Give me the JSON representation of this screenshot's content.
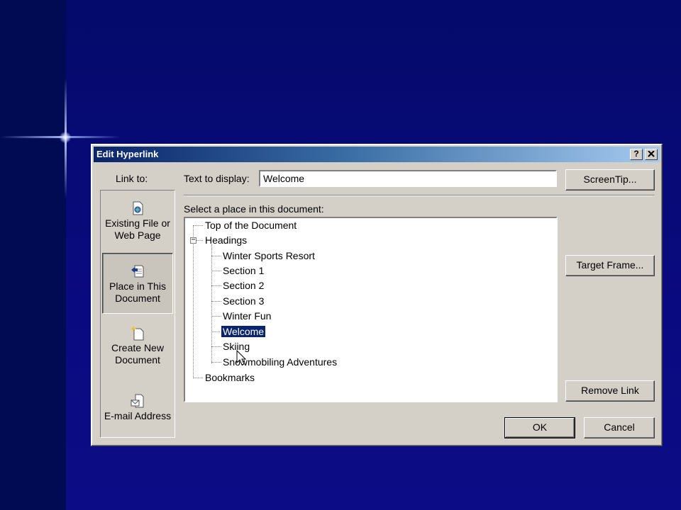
{
  "dialog": {
    "title": "Edit Hyperlink",
    "help_glyph": "?",
    "close_glyph": "✕"
  },
  "link_to": {
    "label": "Link to:",
    "items": [
      {
        "line1": "Existing File or",
        "line2": "Web Page",
        "icon": "existing-file-icon"
      },
      {
        "line1": "Place in This",
        "line2": "Document",
        "icon": "place-in-document-icon",
        "selected": true
      },
      {
        "line1": "Create New",
        "line2": "Document",
        "icon": "create-new-document-icon"
      },
      {
        "line1": "E-mail Address",
        "line2": "",
        "icon": "email-address-icon"
      }
    ]
  },
  "text_to_display": {
    "label": "Text to display:",
    "value": "Welcome"
  },
  "place": {
    "label": "Select a place in this document:",
    "tree": {
      "top": "Top of the Document",
      "headings": "Headings",
      "expander": "−",
      "headings_children": [
        "Winter Sports Resort",
        "Section 1",
        "Section 2",
        "Section 3",
        "Winter Fun",
        "Welcome",
        "Skiing",
        "Snowmobiling Adventures"
      ],
      "selected": "Welcome",
      "bookmarks": "Bookmarks"
    }
  },
  "buttons": {
    "screentip": "ScreenTip...",
    "target_frame": "Target Frame...",
    "remove_link": "Remove Link",
    "ok": "OK",
    "cancel": "Cancel"
  },
  "colors": {
    "desktop": "#0a0a80",
    "titlebar_start": "#0a246a",
    "titlebar_end": "#a6caf0",
    "dialog_face": "#d4d0c8",
    "selection": "#0a246a"
  }
}
